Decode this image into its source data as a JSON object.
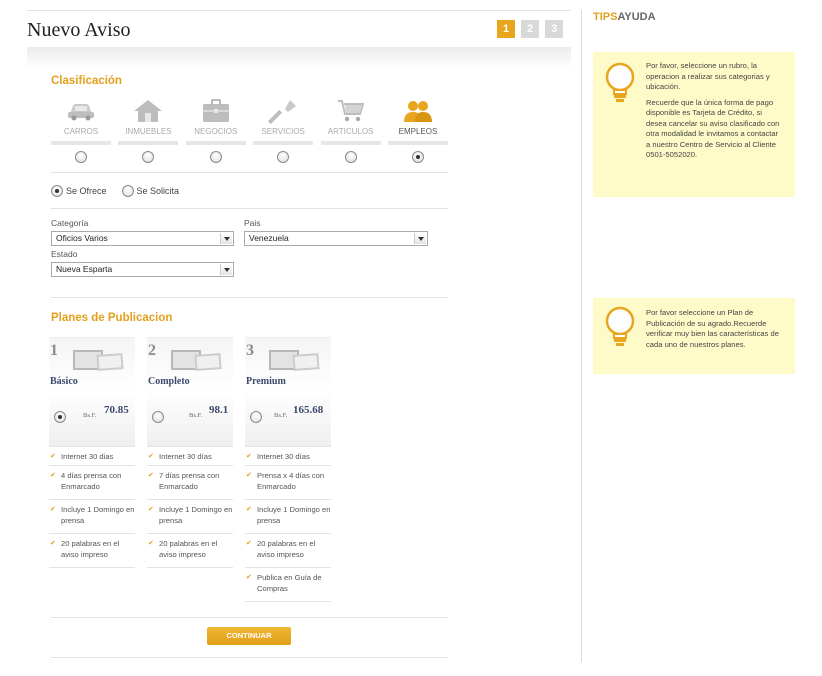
{
  "header": {
    "title": "Nuevo Aviso",
    "steps": [
      "1",
      "2",
      "3"
    ],
    "active_step": 1
  },
  "classification": {
    "title": "Clasificación",
    "categories": [
      {
        "label": "CARROS",
        "icon": "car-icon",
        "selected": false
      },
      {
        "label": "INMUEBLES",
        "icon": "house-icon",
        "selected": false
      },
      {
        "label": "NEGOCIOS",
        "icon": "briefcase-icon",
        "selected": false
      },
      {
        "label": "SERVICIOS",
        "icon": "wrench-icon",
        "selected": false
      },
      {
        "label": "ARTICULOS",
        "icon": "cart-icon",
        "selected": false
      },
      {
        "label": "EMPLEOS",
        "icon": "people-icon",
        "selected": true
      }
    ],
    "offer_options": [
      {
        "label": "Se Ofrece",
        "selected": true
      },
      {
        "label": "Se Solicita",
        "selected": false
      }
    ],
    "fields": {
      "categoria": {
        "label": "Categoría",
        "value": "Oficios Varios"
      },
      "pais": {
        "label": "Pais",
        "value": "Venezuela"
      },
      "estado": {
        "label": "Estado",
        "value": "Nueva Esparta"
      }
    }
  },
  "plans": {
    "title": "Planes de Publicacion",
    "items": [
      {
        "number": "1",
        "name": "Básico",
        "currency": "Bs.F.",
        "price": "70.85",
        "selected": true,
        "features": [
          "Internet 30 dias",
          "4 días prensa con Enmarcado",
          "Incluye 1 Domingo en prensa",
          "20 palabras en el aviso impreso"
        ]
      },
      {
        "number": "2",
        "name": "Completo",
        "currency": "Bs.F.",
        "price": "98.1",
        "selected": false,
        "features": [
          "Internet 30 días",
          "7 días prensa con Enmarcado",
          "Incluye 1 Domingo en prensa",
          "20 palabras en el aviso impreso"
        ]
      },
      {
        "number": "3",
        "name": "Premium",
        "currency": "Bs.F.",
        "price": "165.68",
        "selected": false,
        "features": [
          "Internet 30 días",
          "Prensa x 4 días con Enmarcado",
          "Incluye 1 Domingo en prensa",
          "20 palabras en el aviso impreso",
          "Publica en Guía de Compras"
        ]
      }
    ]
  },
  "continue_label": "CONTINUAR",
  "tips": {
    "title_a": "TIPS",
    "title_b": "AYUDA",
    "box1": {
      "p1": "Por favor, seleccione un rubro, la operacion a realizar sus categorias y ubicación.",
      "p2": "Recuerde que la única forma de pago disponible es Tarjeta de Crédito, si desea cancelar su aviso clasificado con otra modalidad le invitamos a contactar a nuestro Centro de Servicio al Cliente 0501-5052020."
    },
    "box2": {
      "p1": "Por favor seleccione un Plan de Publicación de su agrado.Recuerde verificar muy bien las características de cada uno de nuestros planes."
    }
  },
  "colors": {
    "accent": "#e3a01c",
    "tip_background": "#fffbc9",
    "plan_name": "#3a4a6a"
  }
}
